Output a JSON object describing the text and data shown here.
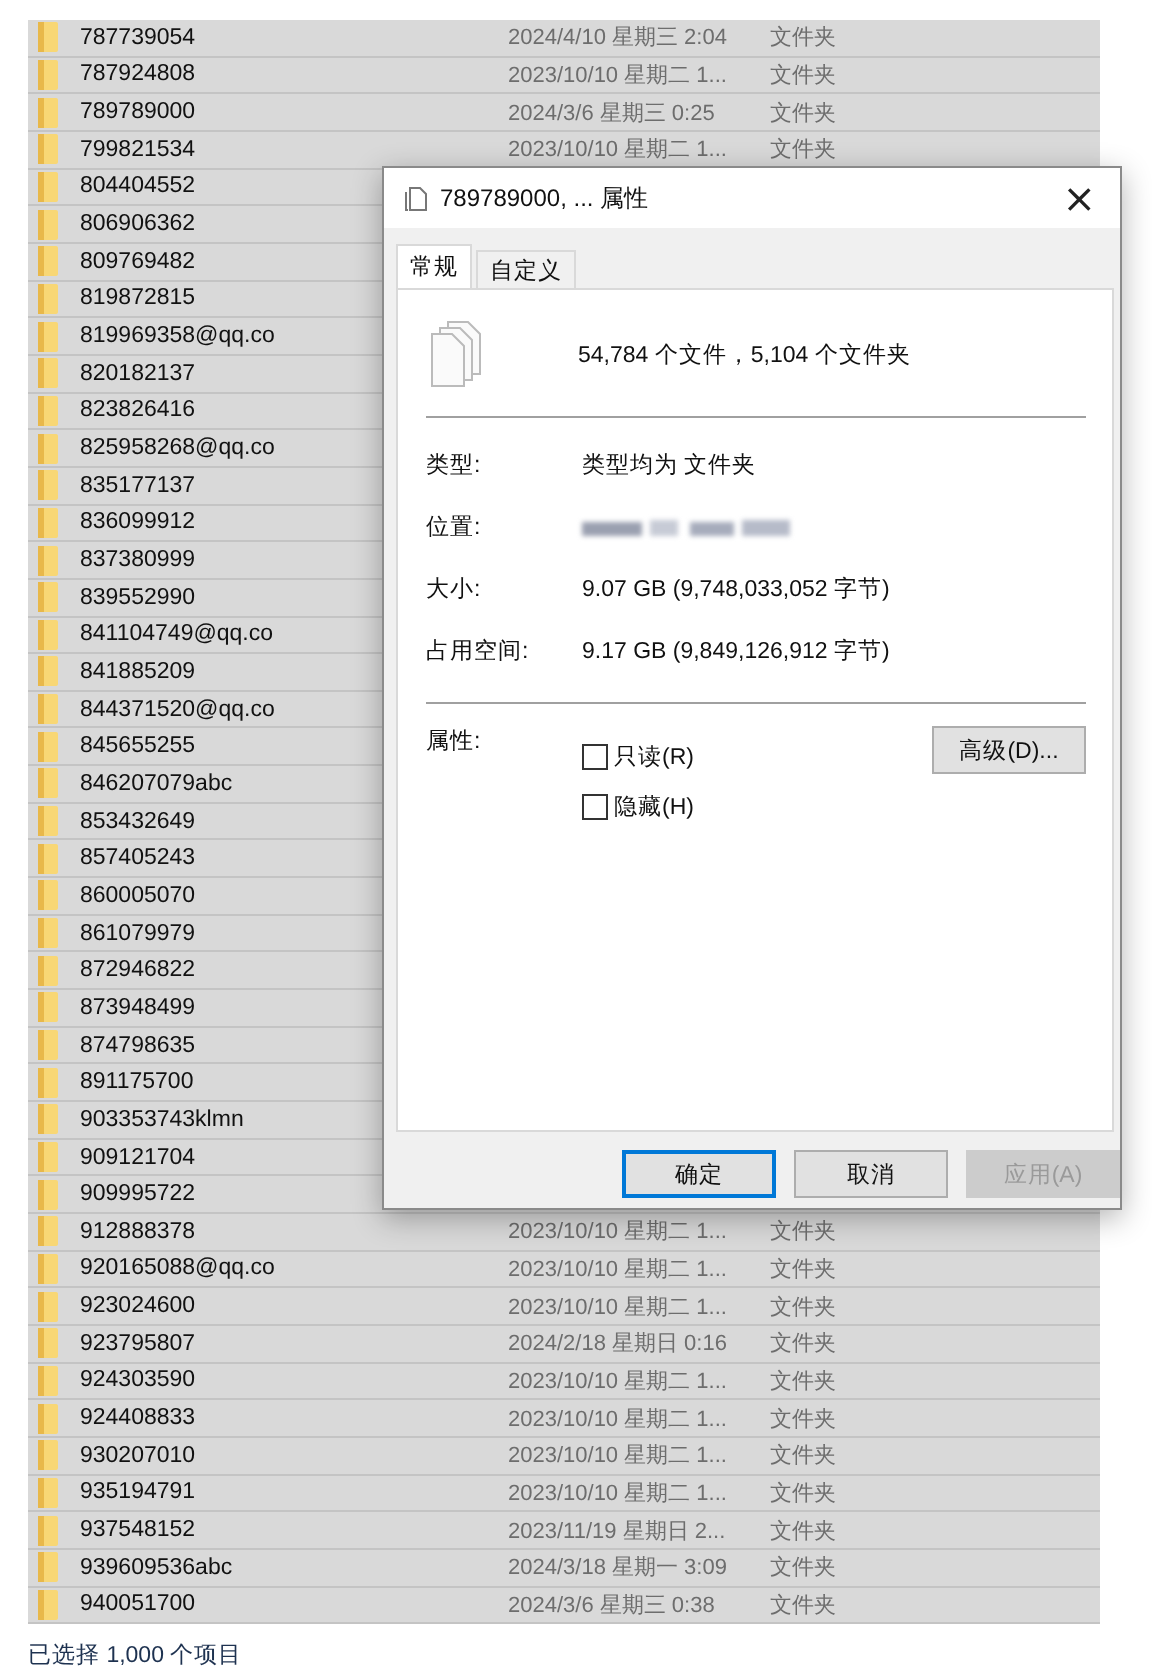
{
  "file_list": {
    "rows": [
      {
        "name": "787739054",
        "date": "2024/4/10 星期三 2:04",
        "type": "文件夹",
        "selected": true
      },
      {
        "name": "787924808",
        "date": "2023/10/10 星期二 1...",
        "type": "文件夹",
        "selected": true
      },
      {
        "name": "789789000",
        "date": "2024/3/6 星期三 0:25",
        "type": "文件夹",
        "selected": true
      },
      {
        "name": "799821534",
        "date": "2023/10/10 星期二 1...",
        "type": "文件夹",
        "selected": true
      },
      {
        "name": "804404552",
        "selected": true
      },
      {
        "name": "806906362",
        "selected": true
      },
      {
        "name": "809769482",
        "selected": true
      },
      {
        "name": "819872815",
        "selected": true
      },
      {
        "name": "819969358@qq.co",
        "selected": true
      },
      {
        "name": "820182137",
        "selected": true
      },
      {
        "name": "823826416",
        "selected": true
      },
      {
        "name": "825958268@qq.co",
        "selected": true
      },
      {
        "name": "835177137",
        "selected": true
      },
      {
        "name": "836099912",
        "selected": true
      },
      {
        "name": "837380999",
        "selected": true
      },
      {
        "name": "839552990",
        "selected": true
      },
      {
        "name": "841104749@qq.co",
        "selected": true
      },
      {
        "name": "841885209",
        "selected": true
      },
      {
        "name": "844371520@qq.co",
        "selected": true
      },
      {
        "name": "845655255",
        "selected": true
      },
      {
        "name": "846207079abc",
        "selected": true
      },
      {
        "name": "853432649",
        "selected": true
      },
      {
        "name": "857405243",
        "selected": true
      },
      {
        "name": "860005070",
        "selected": true
      },
      {
        "name": "861079979",
        "selected": true
      },
      {
        "name": "872946822",
        "selected": true
      },
      {
        "name": "873948499",
        "selected": true
      },
      {
        "name": "874798635",
        "selected": true
      },
      {
        "name": "891175700",
        "selected": true
      },
      {
        "name": "903353743klmn",
        "selected": true
      },
      {
        "name": "909121704",
        "selected": true
      },
      {
        "name": "909995722",
        "selected": true
      },
      {
        "name": "912888378",
        "date": "2023/10/10 星期二 1...",
        "type": "文件夹",
        "selected": true
      },
      {
        "name": "920165088@qq.co",
        "date": "2023/10/10 星期二 1...",
        "type": "文件夹",
        "selected": true
      },
      {
        "name": "923024600",
        "date": "2023/10/10 星期二 1...",
        "type": "文件夹",
        "selected": true
      },
      {
        "name": "923795807",
        "date": "2024/2/18 星期日 0:16",
        "type": "文件夹",
        "selected": true
      },
      {
        "name": "924303590",
        "date": "2023/10/10 星期二 1...",
        "type": "文件夹",
        "selected": true
      },
      {
        "name": "924408833",
        "date": "2023/10/10 星期二 1...",
        "type": "文件夹",
        "selected": true
      },
      {
        "name": "930207010",
        "date": "2023/10/10 星期二 1...",
        "type": "文件夹",
        "selected": true
      },
      {
        "name": "935194791",
        "date": "2023/10/10 星期二 1...",
        "type": "文件夹",
        "selected": true
      },
      {
        "name": "937548152",
        "date": "2023/11/19 星期日 2...",
        "type": "文件夹",
        "selected": true
      },
      {
        "name": "939609536abc",
        "date": "2024/3/18 星期一 3:09",
        "type": "文件夹",
        "selected": true
      },
      {
        "name": "940051700",
        "date": "2024/3/6 星期三 0:38",
        "type": "文件夹",
        "selected": true
      }
    ]
  },
  "status_bar": "已选择 1,000 个项目",
  "dialog": {
    "title": "789789000, ... 属性",
    "close": "×",
    "tabs": [
      {
        "label": "常规",
        "selected": true
      },
      {
        "label": "自定义",
        "selected": false
      }
    ],
    "summary": "54,784 个文件，5,104 个文件夹",
    "properties": [
      {
        "label": "类型:",
        "value": "类型均为 文件夹"
      },
      {
        "label": "位置:",
        "redacted": true
      },
      {
        "label": "大小:",
        "value": "9.07 GB (9,748,033,052 字节)"
      },
      {
        "label": "占用空间:",
        "value": "9.17 GB (9,849,126,912 字节)"
      }
    ],
    "attributes_label": "属性:",
    "checkboxes": [
      {
        "label": "只读(R)",
        "checked": false
      },
      {
        "label": "隐藏(H)",
        "checked": false
      }
    ],
    "advanced_button": "高级(D)...",
    "buttons": [
      {
        "label": "确定",
        "focused": true,
        "disabled": false
      },
      {
        "label": "取消",
        "focused": false,
        "disabled": false
      },
      {
        "label": "应用(A)",
        "focused": false,
        "disabled": true
      }
    ]
  }
}
